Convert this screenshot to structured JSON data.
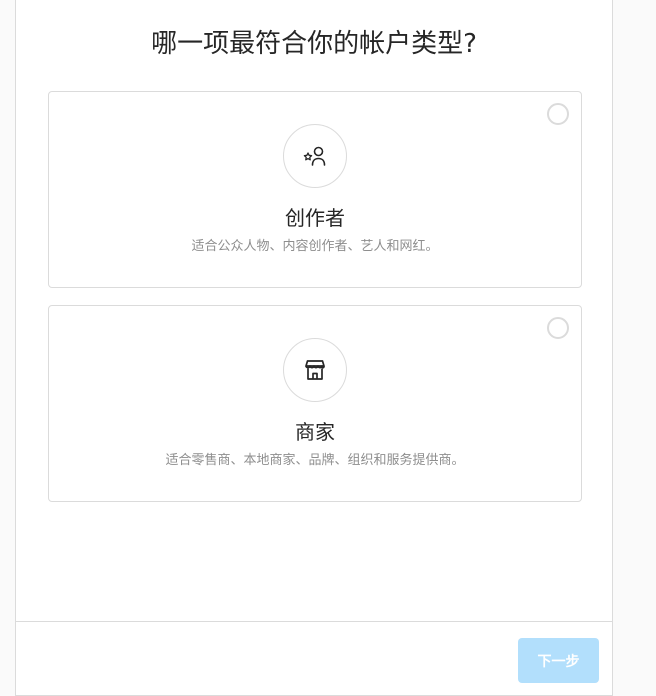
{
  "title": "哪一项最符合你的帐户类型?",
  "options": [
    {
      "icon": "star-person-icon",
      "label": "创作者",
      "description": "适合公众人物、内容创作者、艺人和网红。",
      "selected": false
    },
    {
      "icon": "storefront-icon",
      "label": "商家",
      "description": "适合零售商、本地商家、品牌、组织和服务提供商。",
      "selected": false
    }
  ],
  "footer": {
    "next_label": "下一步",
    "next_enabled": false
  },
  "colors": {
    "border": "#dbdbdb",
    "text_primary": "#262626",
    "text_secondary": "#8e8e8e",
    "button_disabled": "#b2dffc"
  }
}
